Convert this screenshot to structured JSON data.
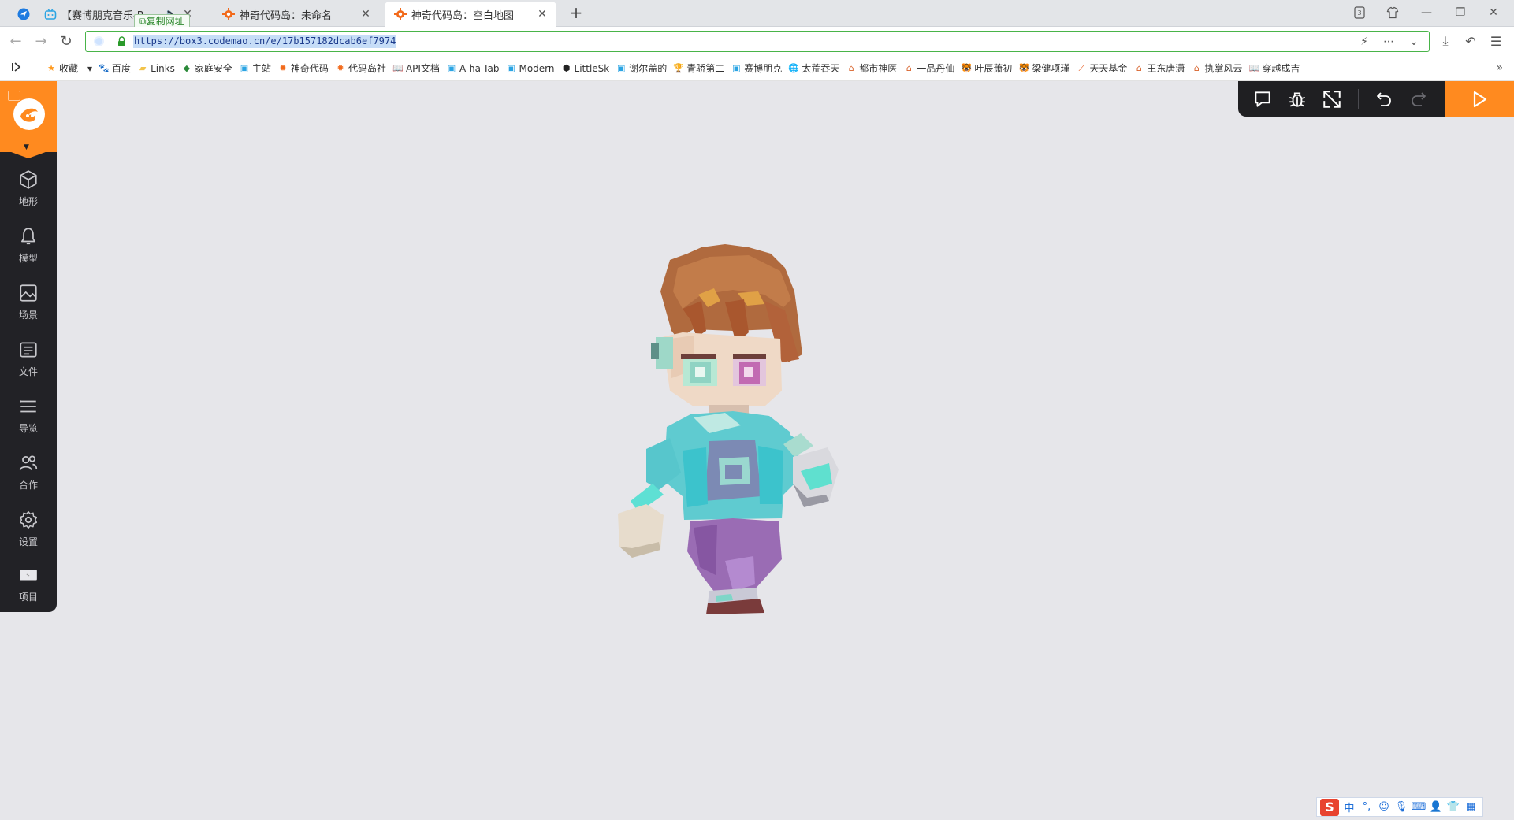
{
  "browser": {
    "tabs": [
      {
        "title": "【赛博朋克音乐-B",
        "icon": "bilibili-icon"
      },
      {
        "title": "神奇代码岛：未命名",
        "icon": "codemao-icon"
      },
      {
        "title": "神奇代码岛：空白地图",
        "icon": "codemao-icon",
        "active": true
      }
    ],
    "copy_tip": "复制网址",
    "url": "https://box3.codemao.cn/e/17b157182dcab6ef7974",
    "bookmarks": [
      {
        "label": "收藏",
        "icon": "star-icon"
      },
      {
        "label": "百度",
        "icon": "baidu-icon"
      },
      {
        "label": "Links",
        "icon": "folder-icon"
      },
      {
        "label": "家庭安全",
        "icon": "shield-icon"
      },
      {
        "label": "主站",
        "icon": "bilibili-icon"
      },
      {
        "label": "神奇代码",
        "icon": "codemao-icon"
      },
      {
        "label": "代码岛社",
        "icon": "codemao-icon"
      },
      {
        "label": "API文档",
        "icon": "book-icon"
      },
      {
        "label": "A ha-Tab",
        "icon": "bilibili-icon"
      },
      {
        "label": "Modern",
        "icon": "bilibili-icon"
      },
      {
        "label": "LittleSk",
        "icon": "cube-icon"
      },
      {
        "label": "谢尔盖的",
        "icon": "bilibili-icon"
      },
      {
        "label": "青骄第二",
        "icon": "trophy-icon"
      },
      {
        "label": "赛博朋克",
        "icon": "bilibili-icon"
      },
      {
        "label": "太荒吞天",
        "icon": "globe-icon"
      },
      {
        "label": "都市神医",
        "icon": "house-icon"
      },
      {
        "label": "一品丹仙",
        "icon": "house-icon"
      },
      {
        "label": "叶辰萧初",
        "icon": "tiger-icon"
      },
      {
        "label": "梁健项瑾",
        "icon": "tiger-icon"
      },
      {
        "label": "天天基金",
        "icon": "fund-icon"
      },
      {
        "label": "王东唐潇",
        "icon": "house-icon"
      },
      {
        "label": "执掌风云",
        "icon": "house-icon"
      },
      {
        "label": "穿越成吉",
        "icon": "book-icon"
      }
    ]
  },
  "sidebar": {
    "items": [
      {
        "label": "地形",
        "icon": "cube-icon"
      },
      {
        "label": "模型",
        "icon": "bell-icon"
      },
      {
        "label": "场景",
        "icon": "image-icon"
      },
      {
        "label": "文件",
        "icon": "file-icon"
      },
      {
        "label": "导览",
        "icon": "list-icon"
      },
      {
        "label": "合作",
        "icon": "users-icon"
      },
      {
        "label": "设置",
        "icon": "gear-icon"
      }
    ],
    "project_label": "项目"
  },
  "toolbar": {
    "buttons": [
      "chat-icon",
      "debug-icon",
      "fullscreen-icon",
      "undo-icon",
      "redo-icon"
    ],
    "run": "play-icon"
  },
  "ime": {
    "brand": "S",
    "mode": "中"
  },
  "colors": {
    "accent": "#ff8a1f",
    "sidebar_bg": "#222226",
    "canvas_bg": "#e6e6ea"
  }
}
